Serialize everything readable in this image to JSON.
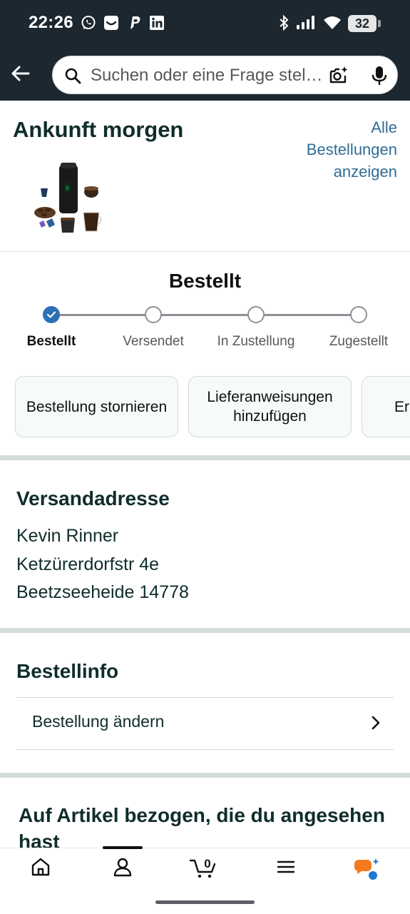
{
  "status_bar": {
    "time": "22:26",
    "battery": "32",
    "notification_icons": [
      "whatsapp-icon",
      "inbox-icon",
      "paypal-icon",
      "linkedin-icon"
    ],
    "system_icons": [
      "bluetooth-icon",
      "signal-icon",
      "wifi-icon",
      "battery-icon"
    ]
  },
  "search": {
    "placeholder": "Suchen oder eine Frage stellen"
  },
  "arrival": {
    "title": "Ankunft morgen",
    "all_orders_link": "Alle Bestellungen anzeigen"
  },
  "tracker": {
    "heading": "Bestellt",
    "progress_step": 1,
    "steps": [
      {
        "label": "Bestellt"
      },
      {
        "label": "Versendet"
      },
      {
        "label": "In Zustellung"
      },
      {
        "label": "Zugestellt"
      }
    ]
  },
  "actions": [
    {
      "label": "Bestellung stornieren"
    },
    {
      "label": "Lieferanweisungen hinzufügen"
    },
    {
      "label": "Er"
    }
  ],
  "address": {
    "title": "Versandadresse",
    "name": "Kevin Rinner",
    "street": "Ketzürerdorfstr 4e",
    "city": "Beetzseeheide 14778"
  },
  "order_info": {
    "title": "Bestellinfo",
    "change_order": "Bestellung ändern"
  },
  "viewed": {
    "title": "Auf Artikel bezogen, die du angesehen hast"
  },
  "bottom_nav": {
    "cart_count": "0",
    "items": [
      "home-icon",
      "account-icon",
      "cart-icon",
      "menu-icon",
      "rufus-icon"
    ]
  },
  "colors": {
    "header": "#1c2730",
    "link": "#2f6d95",
    "progress": "#2d6fb4",
    "heading": "#0f2d2b"
  }
}
